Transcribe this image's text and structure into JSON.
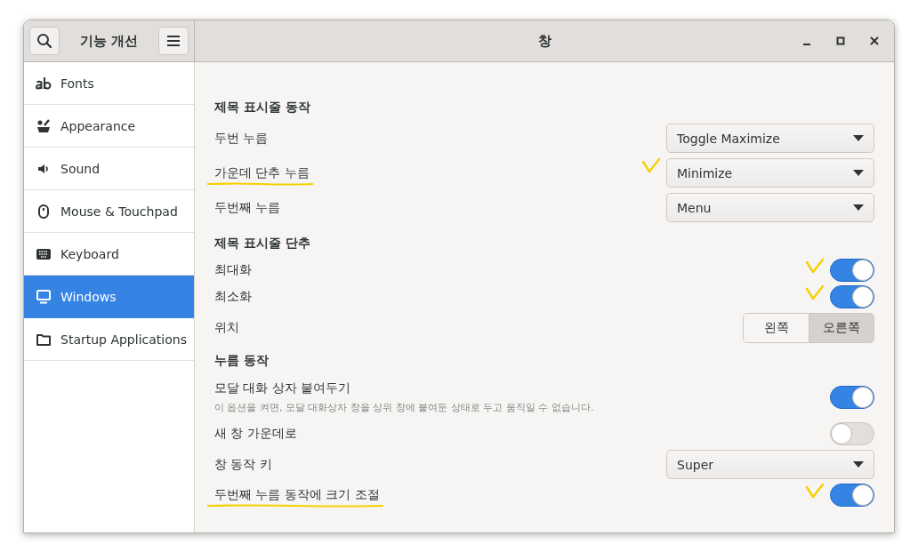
{
  "sidebar_header": {
    "title": "기능 개선"
  },
  "window": {
    "title": "창"
  },
  "sidebar": {
    "items": [
      {
        "label": "Fonts",
        "selected": false
      },
      {
        "label": "Appearance",
        "selected": false
      },
      {
        "label": "Sound",
        "selected": false
      },
      {
        "label": "Mouse & Touchpad",
        "selected": false
      },
      {
        "label": "Keyboard",
        "selected": false
      },
      {
        "label": "Windows",
        "selected": true
      },
      {
        "label": "Startup Applications",
        "selected": false
      }
    ]
  },
  "sections": [
    {
      "title": "제목 표시줄 동작",
      "items": [
        {
          "kind": "dropdown",
          "label": "두번 누름",
          "value": "Toggle Maximize",
          "underlined": false,
          "ticked": false
        },
        {
          "kind": "dropdown",
          "label": "가운데 단추 누름",
          "value": "Minimize",
          "underlined": true,
          "ticked": true
        },
        {
          "kind": "dropdown",
          "label": "두번째 누름",
          "value": "Menu",
          "underlined": false,
          "ticked": false
        }
      ]
    },
    {
      "title": "제목 표시줄 단추",
      "items": [
        {
          "kind": "switch",
          "label": "최대화",
          "on": true,
          "underlined": false,
          "ticked": true
        },
        {
          "kind": "switch",
          "label": "최소화",
          "on": true,
          "underlined": false,
          "ticked": true
        },
        {
          "kind": "segmented",
          "label": "위치",
          "options": [
            {
              "label": "왼쪽",
              "selected": false
            },
            {
              "label": "오른쪽",
              "selected": true
            }
          ],
          "underlined": false,
          "ticked": false
        }
      ]
    },
    {
      "title": "누름 동작",
      "items": [
        {
          "kind": "switch",
          "label": "모달 대화 상자 붙여두기",
          "description": "이 옵션을 켜면, 모달 대화상자 창을 상위 창에 붙여둔 상태로 두고 움직일 수 없습니다.",
          "on": true,
          "underlined": false,
          "ticked": false
        },
        {
          "kind": "switch",
          "label": "새 창 가운데로",
          "on": false,
          "underlined": false,
          "ticked": false
        },
        {
          "kind": "dropdown",
          "label": "창 동작 키",
          "value": "Super",
          "underlined": false,
          "ticked": false
        },
        {
          "kind": "switch",
          "label": "두번째 누름 동작에 크기 조절",
          "on": true,
          "underlined": true,
          "ticked": true
        }
      ]
    }
  ]
}
